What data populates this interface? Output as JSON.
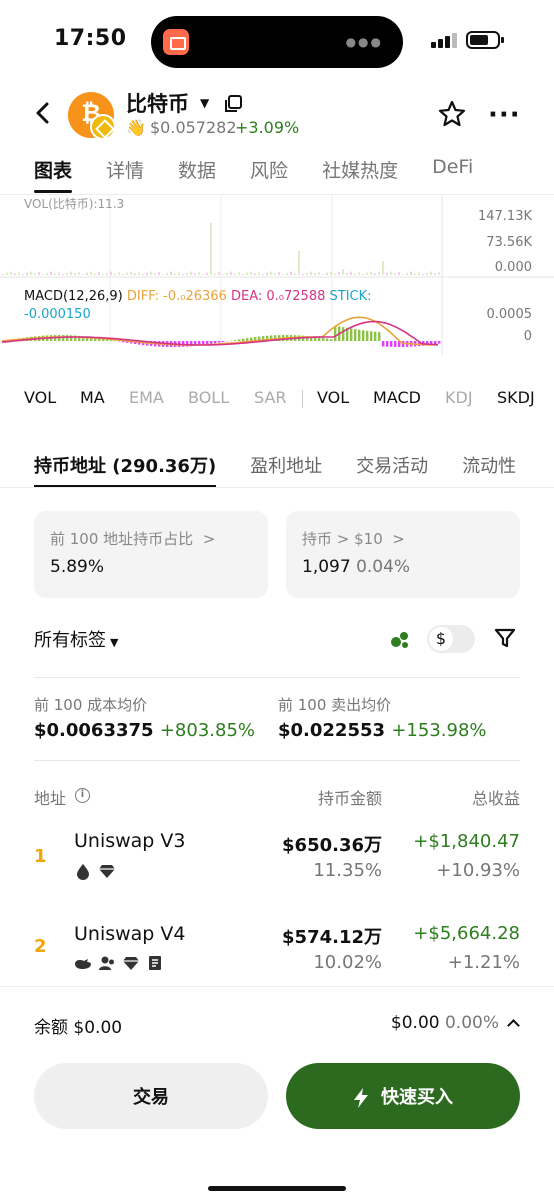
{
  "status_bar": {
    "time": "17:50"
  },
  "header": {
    "coin_name": "比特币",
    "coin_logo_glyph": "₿",
    "price": "$0.057282",
    "change": "+3.09%"
  },
  "main_tabs": [
    "图表",
    "详情",
    "数据",
    "风险",
    "社媒热度",
    "DeFi"
  ],
  "chart": {
    "vol_label": "VOL(比特币):11.3",
    "vol_axis": [
      "147.13K",
      "73.56K",
      "0.000"
    ],
    "macd": {
      "name": "MACD(12,26,9)",
      "diff": "DIFF: -0.₀26366",
      "dea": "DEA: 0.₀72588",
      "stick_label": "STICK:",
      "stick_value": "-0.000150"
    },
    "macd_axis": [
      "0.0005",
      "0"
    ],
    "colors": {
      "diff": "#e8a33b",
      "dea": "#d63384",
      "stick": "#1aa6c9",
      "up": "#8bc34a",
      "down": "#e040fb"
    }
  },
  "indicators": {
    "main": [
      {
        "label": "VOL",
        "dim": false
      },
      {
        "label": "MA",
        "dim": false
      },
      {
        "label": "EMA",
        "dim": true
      },
      {
        "label": "BOLL",
        "dim": true
      },
      {
        "label": "SAR",
        "dim": true
      }
    ],
    "sub": [
      {
        "label": "VOL",
        "dim": false
      },
      {
        "label": "MACD",
        "dim": false
      },
      {
        "label": "KDJ",
        "dim": true
      },
      {
        "label": "SKDJ",
        "dim": false
      }
    ]
  },
  "sub_tabs": [
    "持币地址 (290.36万)",
    "盈利地址",
    "交易活动",
    "流动性"
  ],
  "cards": [
    {
      "label": "前 100 地址持币占比",
      "value": "5.89%",
      "extra": ""
    },
    {
      "label": "持币 > $10",
      "value": "1,097",
      "extra": "0.04%"
    }
  ],
  "filter": {
    "label": "所有标签",
    "currency": "$"
  },
  "averages": [
    {
      "label": "前 100 成本均价",
      "value": "$0.0063375",
      "change": "+803.85%"
    },
    {
      "label": "前 100 卖出均价",
      "value": "$0.022553",
      "change": "+153.98%"
    }
  ],
  "table": {
    "headers": {
      "address": "地址",
      "amount": "持币金额",
      "profit": "总收益"
    },
    "rows": [
      {
        "rank": "1",
        "name": "Uniswap V3",
        "amount": "$650.36万",
        "amount_pct": "11.35%",
        "profit": "+$1,840.47",
        "profit_pct": "+10.93%",
        "tags": [
          "drop-icon",
          "diamond-icon"
        ]
      },
      {
        "rank": "2",
        "name": "Uniswap V4",
        "amount": "$574.12万",
        "amount_pct": "10.02%",
        "profit": "+$5,664.28",
        "profit_pct": "+1.21%",
        "tags": [
          "whale-icon",
          "users-icon",
          "diamond-icon",
          "bookmark-icon"
        ]
      }
    ]
  },
  "bottom": {
    "balance": "余额 $0.00",
    "balance_value": "$0.00",
    "balance_pct": "0.00%",
    "trade_label": "交易",
    "buy_label": "快速买入"
  }
}
